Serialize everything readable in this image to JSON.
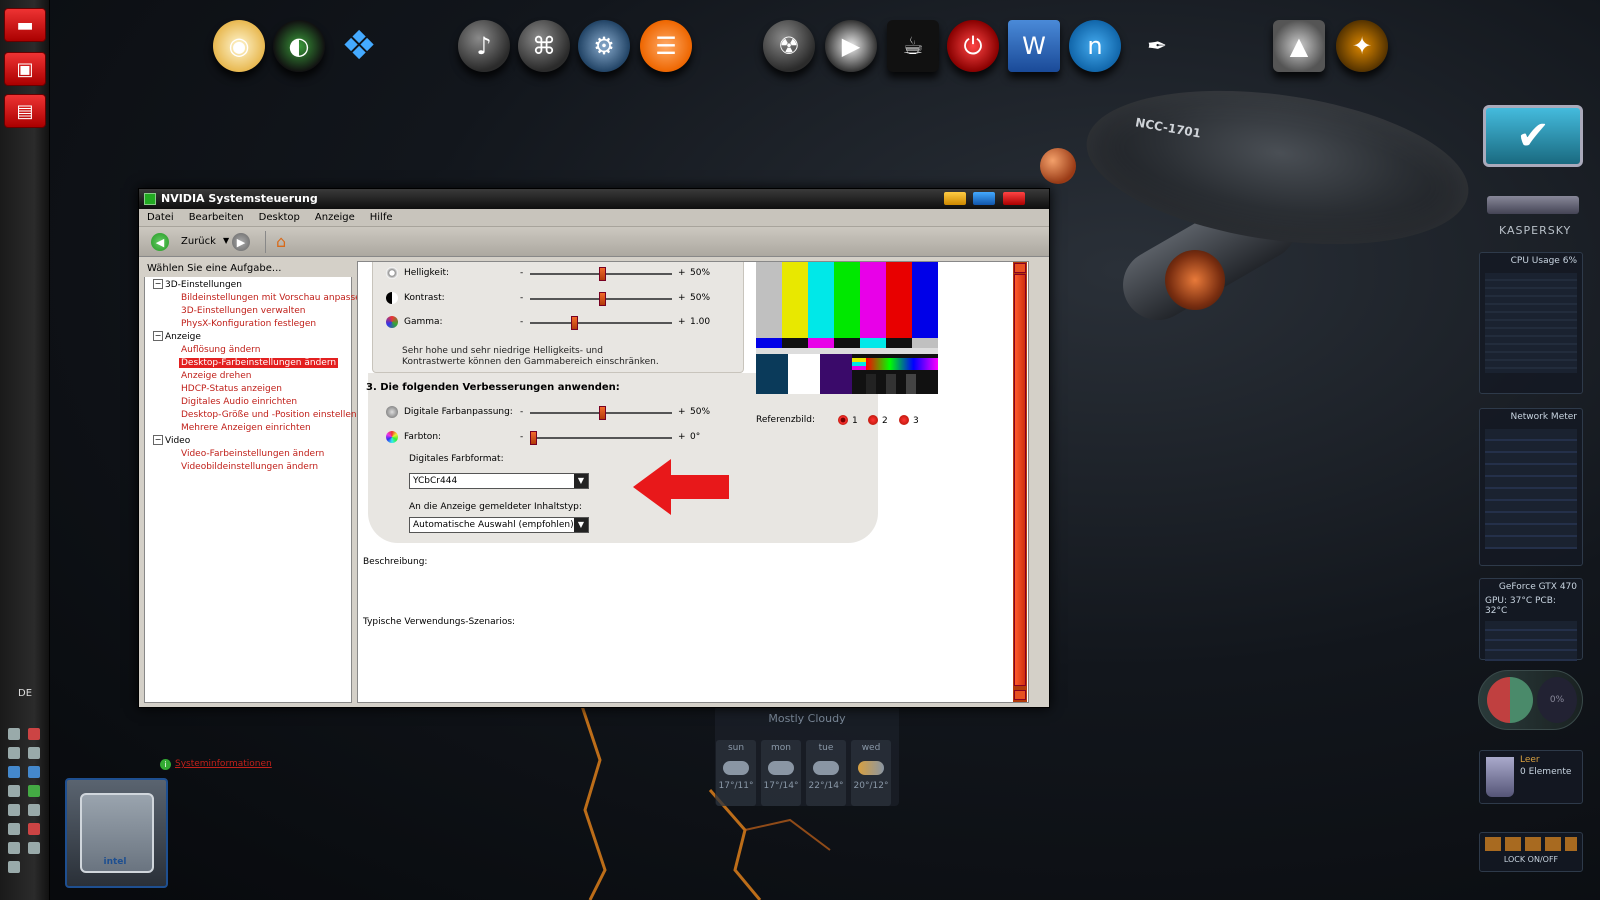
{
  "window": {
    "title": "NVIDIA Systemsteuerung"
  },
  "menu": [
    "Datei",
    "Bearbeiten",
    "Desktop",
    "Anzeige",
    "Hilfe"
  ],
  "toolbar": {
    "back_label": "Zurück"
  },
  "task_panel": {
    "header": "Wählen Sie eine Aufgabe...",
    "categories": [
      {
        "label": "3D-Einstellungen",
        "items": [
          "Bildeinstellungen mit Vorschau anpassen",
          "3D-Einstellungen verwalten",
          "PhysX-Konfiguration festlegen"
        ]
      },
      {
        "label": "Anzeige",
        "items": [
          "Auflösung ändern",
          "Desktop-Farbeinstellungen ändern",
          "Anzeige drehen",
          "HDCP-Status anzeigen",
          "Digitales Audio einrichten",
          "Desktop-Größe und -Position einstellen",
          "Mehrere Anzeigen einrichten"
        ]
      },
      {
        "label": "Video",
        "items": [
          "Video-Farbeinstellungen ändern",
          "Videobildeinstellungen ändern"
        ]
      }
    ],
    "selected_item": "Desktop-Farbeinstellungen ändern",
    "sysinfo_link": "Systeminformationen"
  },
  "settings": {
    "sliders": [
      {
        "label": "Helligkeit:",
        "value_text": "50%",
        "fraction": 0.5
      },
      {
        "label": "Kontrast:",
        "value_text": "50%",
        "fraction": 0.5
      },
      {
        "label": "Gamma:",
        "value_text": "1.00",
        "fraction": 0.3
      }
    ],
    "gamma_note": "Sehr hohe und sehr niedrige Helligkeits- und Kontrastwerte können den Gammabereich einschränken.",
    "section3_title": "3. Die folgenden Verbesserungen anwenden:",
    "enhancements": [
      {
        "label": "Digitale Farbanpassung:",
        "value_text": "50%",
        "fraction": 0.5
      },
      {
        "label": "Farbton:",
        "value_text": "0°",
        "fraction": 0.0
      }
    ],
    "slider_minus": "-",
    "slider_plus": "+",
    "color_format_label": "Digitales Farbformat:",
    "color_format_value": "YCbCr444",
    "content_type_label": "An die Anzeige gemeldeter Inhaltstyp:",
    "content_type_value": "Automatische Auswahl (empfohlen)",
    "reference_label": "Referenzbild:",
    "reference_options": [
      "1",
      "2",
      "3"
    ],
    "reference_selected": "1",
    "description_label": "Beschreibung:",
    "scenarios_label": "Typische Verwendungs-Szenarios:"
  },
  "desktop": {
    "language": "DE",
    "ship_registry": "NCC-1701",
    "kaspersky_label": "KASPERSKY",
    "weather": {
      "title": "Mostly Cloudy",
      "days": [
        {
          "day": "sun",
          "temp": "17°/11°"
        },
        {
          "day": "mon",
          "temp": "17°/14°"
        },
        {
          "day": "tue",
          "temp": "22°/14°"
        },
        {
          "day": "wed",
          "temp": "20°/12°"
        }
      ]
    },
    "gadgets": {
      "cpu_title": "CPU Usage",
      "cpu_value": "6%",
      "network_title": "Network Meter",
      "gpu_title": "GeForce GTX 470",
      "gpu_temp": "GPU: 37°C",
      "pcb_temp": "PCB: 32°C",
      "recycle_title": "Leer",
      "recycle_count": "0 Elemente",
      "lock_label": "LOCK ON/OFF",
      "gauge_value": "0%"
    },
    "intel_label": "intel"
  },
  "colors": {
    "accent_red": "#e32020",
    "link_red": "#c0201a",
    "slider_orange": "#f26a2a"
  }
}
